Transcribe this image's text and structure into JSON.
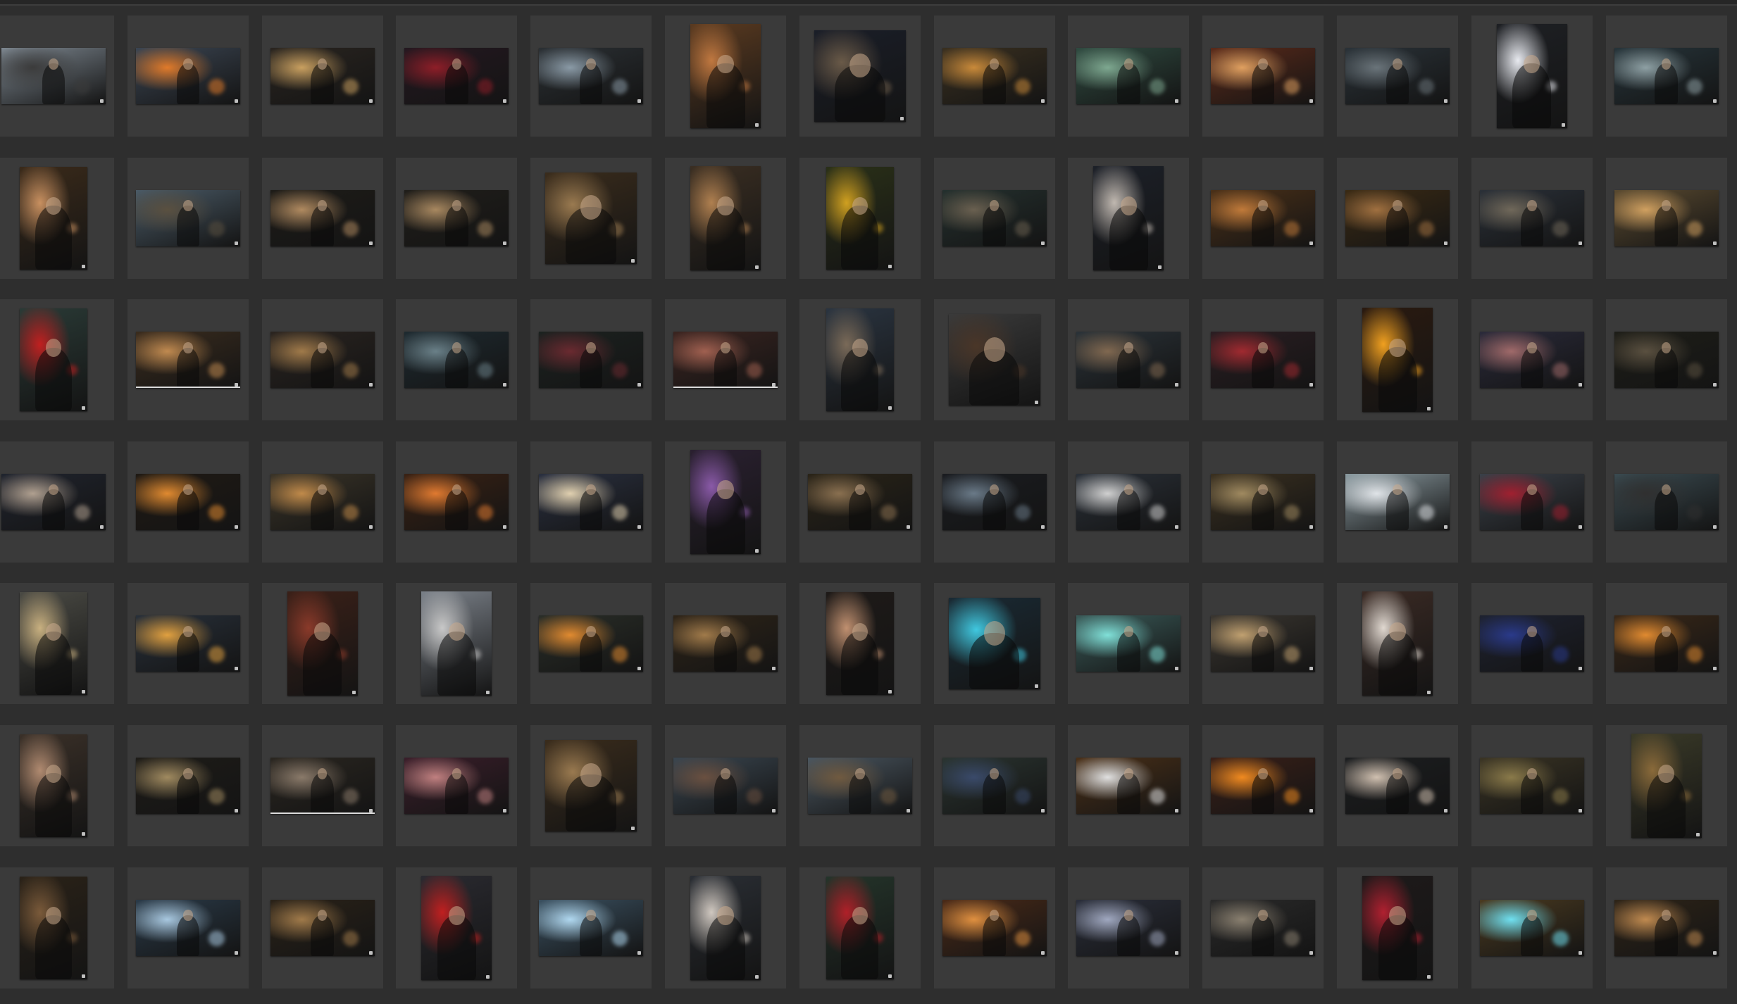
{
  "gallery": {
    "columns": 13,
    "rows": 7,
    "colors": {
      "background": "#2e2e2e",
      "cell": "#3a3a3a",
      "separator": "#3d3d3d"
    },
    "items": [
      {
        "shape": "landscape",
        "tone": "#7d8790",
        "accent": "#3b3b3b"
      },
      {
        "shape": "landscape",
        "tone": "#3b4552",
        "accent": "#e07a2a"
      },
      {
        "shape": "landscape",
        "tone": "#2a2520",
        "accent": "#c9a060"
      },
      {
        "shape": "landscape",
        "tone": "#241820",
        "accent": "#8e1e28"
      },
      {
        "shape": "landscape",
        "tone": "#2b3034",
        "accent": "#8a9aa6"
      },
      {
        "shape": "portrait",
        "tone": "#5a3a20",
        "accent": "#c07840"
      },
      {
        "shape": "square",
        "tone": "#1a1e28",
        "accent": "#6a5a48"
      },
      {
        "shape": "landscape",
        "tone": "#3a3020",
        "accent": "#c98a3a"
      },
      {
        "shape": "landscape",
        "tone": "#2f4a40",
        "accent": "#7ea890"
      },
      {
        "shape": "landscape",
        "tone": "#5a2a1a",
        "accent": "#e0a060"
      },
      {
        "shape": "landscape",
        "tone": "#2a3238",
        "accent": "#6a747a"
      },
      {
        "shape": "portrait",
        "tone": "#1e2024",
        "accent": "#e8eaf0"
      },
      {
        "shape": "landscape",
        "tone": "#26343a",
        "accent": "#8ea0a4"
      },
      {
        "shape": "portrait",
        "tone": "#3a2a1a",
        "accent": "#c89060"
      },
      {
        "shape": "landscape",
        "tone": "#4a5a66",
        "accent": "#5a5040"
      },
      {
        "shape": "landscape",
        "tone": "#1e1c18",
        "accent": "#b08a60"
      },
      {
        "shape": "landscape",
        "tone": "#201e1a",
        "accent": "#a88860"
      },
      {
        "shape": "square",
        "tone": "#3a2c1c",
        "accent": "#9a7a50"
      },
      {
        "shape": "portrait",
        "tone": "#3a2e22",
        "accent": "#b08050"
      },
      {
        "shape": "portrait",
        "tone": "#2a3018",
        "accent": "#d0a020"
      },
      {
        "shape": "landscape",
        "tone": "#24302e",
        "accent": "#6a6050"
      },
      {
        "shape": "portrait",
        "tone": "#1c2028",
        "accent": "#c0b8b0"
      },
      {
        "shape": "landscape",
        "tone": "#4a3018",
        "accent": "#c07a3a"
      },
      {
        "shape": "landscape",
        "tone": "#3a2a14",
        "accent": "#a07040"
      },
      {
        "shape": "landscape",
        "tone": "#2a3038",
        "accent": "#70685a"
      },
      {
        "shape": "landscape",
        "tone": "#5a4a30",
        "accent": "#d0a060"
      },
      {
        "shape": "portrait",
        "tone": "#2a3a36",
        "accent": "#c02020"
      },
      {
        "shape": "landscape",
        "tone": "#3a2c1e",
        "accent": "#c08a50"
      },
      {
        "shape": "landscape",
        "tone": "#2a2420",
        "accent": "#a07a4a"
      },
      {
        "shape": "landscape",
        "tone": "#1e2a30",
        "accent": "#6a8088"
      },
      {
        "shape": "landscape",
        "tone": "#1c2220",
        "accent": "#6a2a30"
      },
      {
        "shape": "landscape",
        "tone": "#3a2420",
        "accent": "#a06050"
      },
      {
        "shape": "portrait",
        "tone": "#2a3440",
        "accent": "#7a6a58"
      },
      {
        "shape": "square",
        "tone": "#3a3a3a",
        "accent": "#4a3628"
      },
      {
        "shape": "landscape",
        "tone": "#2a3238",
        "accent": "#806850"
      },
      {
        "shape": "landscape",
        "tone": "#2a1e22",
        "accent": "#a02a30"
      },
      {
        "shape": "portrait",
        "tone": "#2a1a10",
        "accent": "#f0a020"
      },
      {
        "shape": "landscape",
        "tone": "#2a2a3a",
        "accent": "#a06a6a"
      },
      {
        "shape": "landscape",
        "tone": "#1e1e18",
        "accent": "#5a5040"
      },
      {
        "shape": "landscape",
        "tone": "#20242e",
        "accent": "#b0a090"
      },
      {
        "shape": "landscape",
        "tone": "#201a14",
        "accent": "#e08a30"
      },
      {
        "shape": "landscape",
        "tone": "#3a3428",
        "accent": "#c08a4a"
      },
      {
        "shape": "landscape",
        "tone": "#3a2214",
        "accent": "#e07a30"
      },
      {
        "shape": "landscape",
        "tone": "#2a3040",
        "accent": "#e0d0b0"
      },
      {
        "shape": "portrait",
        "tone": "#2a2030",
        "accent": "#8a5aa8"
      },
      {
        "shape": "landscape",
        "tone": "#2a2418",
        "accent": "#8a7050"
      },
      {
        "shape": "landscape",
        "tone": "#1a1c20",
        "accent": "#6a7a88"
      },
      {
        "shape": "landscape",
        "tone": "#2a3038",
        "accent": "#d0d0d0"
      },
      {
        "shape": "landscape",
        "tone": "#3a3020",
        "accent": "#a08a60"
      },
      {
        "shape": "landscape",
        "tone": "#8a9aa0",
        "accent": "#e0e4e8"
      },
      {
        "shape": "landscape",
        "tone": "#3a4048",
        "accent": "#a02030"
      },
      {
        "shape": "landscape",
        "tone": "#3a4a50",
        "accent": "#303030"
      },
      {
        "shape": "portrait",
        "tone": "#4a4a44",
        "accent": "#c8b080"
      },
      {
        "shape": "landscape",
        "tone": "#28303a",
        "accent": "#e0a040"
      },
      {
        "shape": "portrait",
        "tone": "#3a2018",
        "accent": "#8a3a2a"
      },
      {
        "shape": "portrait",
        "tone": "#7a8088",
        "accent": "#c8c8c8"
      },
      {
        "shape": "landscape",
        "tone": "#2a2e28",
        "accent": "#e08a30"
      },
      {
        "shape": "landscape",
        "tone": "#2e2418",
        "accent": "#a07a4a"
      },
      {
        "shape": "portrait",
        "tone": "#1e1a18",
        "accent": "#c09070"
      },
      {
        "shape": "square",
        "tone": "#1a2a34",
        "accent": "#40c8e0"
      },
      {
        "shape": "landscape",
        "tone": "#3a5a58",
        "accent": "#80e0d8"
      },
      {
        "shape": "landscape",
        "tone": "#3a3630",
        "accent": "#c0a070"
      },
      {
        "shape": "portrait",
        "tone": "#3a2a24",
        "accent": "#e0d8d0"
      },
      {
        "shape": "landscape",
        "tone": "#1e2230",
        "accent": "#2a3a8a"
      },
      {
        "shape": "landscape",
        "tone": "#3a2818",
        "accent": "#e08a30"
      },
      {
        "shape": "portrait",
        "tone": "#3a3028",
        "accent": "#b08a70"
      },
      {
        "shape": "landscape",
        "tone": "#1e1c18",
        "accent": "#a08a60"
      },
      {
        "shape": "landscape",
        "tone": "#2a2620",
        "accent": "#8a7a6a"
      },
      {
        "shape": "landscape",
        "tone": "#3a1e2a",
        "accent": "#c08080"
      },
      {
        "shape": "square",
        "tone": "#3a2c1c",
        "accent": "#9a7a50"
      },
      {
        "shape": "landscape",
        "tone": "#3a4650",
        "accent": "#6a5040"
      },
      {
        "shape": "landscape",
        "tone": "#4a5660",
        "accent": "#705a40"
      },
      {
        "shape": "landscape",
        "tone": "#2a3430",
        "accent": "#3a4a6a"
      },
      {
        "shape": "landscape",
        "tone": "#4a3018",
        "accent": "#e0e0e0"
      },
      {
        "shape": "landscape",
        "tone": "#3a2018",
        "accent": "#f08a20"
      },
      {
        "shape": "landscape",
        "tone": "#1c1e20",
        "accent": "#d0c0b0"
      },
      {
        "shape": "landscape",
        "tone": "#3a3424",
        "accent": "#8a7a4a"
      },
      {
        "shape": "portrait",
        "tone": "#3a3a28",
        "accent": "#8a6a3a"
      },
      {
        "shape": "portrait",
        "tone": "#2a2218",
        "accent": "#7a5a3a"
      },
      {
        "shape": "landscape",
        "tone": "#2a3a48",
        "accent": "#a8c8e0"
      },
      {
        "shape": "landscape",
        "tone": "#2a2218",
        "accent": "#a07a4a"
      },
      {
        "shape": "portrait",
        "tone": "#2a2a30",
        "accent": "#c02020"
      },
      {
        "shape": "landscape",
        "tone": "#3a5060",
        "accent": "#b0d8f0"
      },
      {
        "shape": "portrait",
        "tone": "#2a2e34",
        "accent": "#d0c8c0"
      },
      {
        "shape": "portrait",
        "tone": "#24342a",
        "accent": "#b02028"
      },
      {
        "shape": "landscape",
        "tone": "#4a2a18",
        "accent": "#e09040"
      },
      {
        "shape": "landscape",
        "tone": "#2a2e3a",
        "accent": "#a0a8c0"
      },
      {
        "shape": "landscape",
        "tone": "#2a2a2a",
        "accent": "#8a8070"
      },
      {
        "shape": "portrait",
        "tone": "#1e1a1a",
        "accent": "#b02030"
      },
      {
        "shape": "landscape",
        "tone": "#4a3a20",
        "accent": "#70e0f0"
      },
      {
        "shape": "landscape",
        "tone": "#2e2418",
        "accent": "#c08a50"
      }
    ]
  }
}
